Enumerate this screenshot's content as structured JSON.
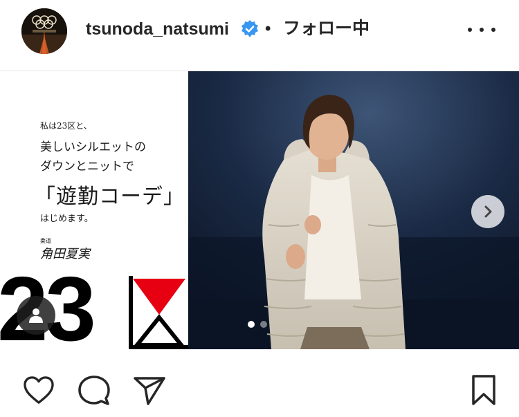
{
  "post_header": {
    "username": "tsunoda_natsumi",
    "separator": "•",
    "follow_status": "フォロー中",
    "verified_color": "#3897f0"
  },
  "ad": {
    "line1": "私は23区と、",
    "line2": "美しいシルエットの",
    "line3": "ダウンとニットで",
    "line4": "「遊勤コーデ」",
    "line5": "はじめます。",
    "signature_label": "柔道",
    "signature": "角田夏実",
    "brand_number": "23",
    "brand_color": "#e60012"
  },
  "carousel": {
    "slide_count": 2,
    "active_index": 0
  },
  "icons": {
    "like": "heart-icon",
    "comment": "comment-icon",
    "share": "share-icon",
    "save": "bookmark-icon",
    "user_tag": "person-icon",
    "next": "chevron-right-icon",
    "more": "more-options-icon"
  }
}
